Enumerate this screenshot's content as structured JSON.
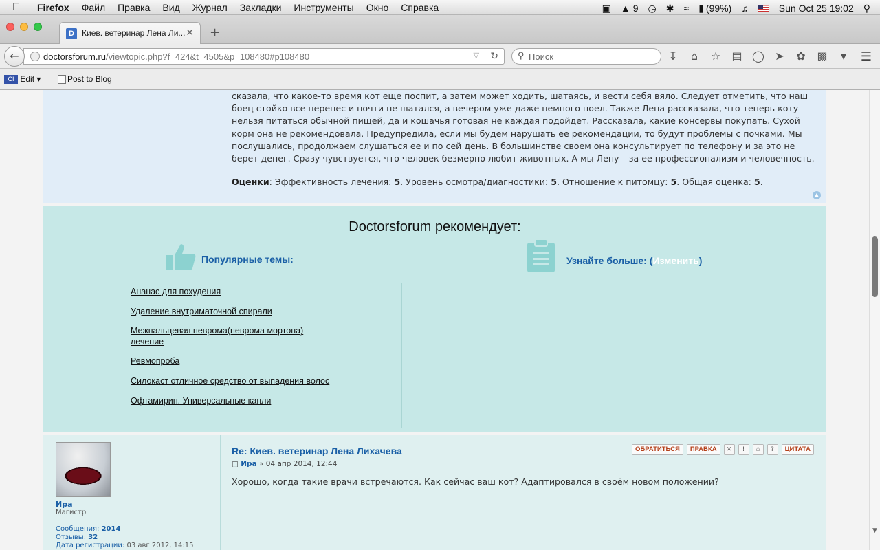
{
  "menubar": {
    "app": "Firefox",
    "items": [
      "Файл",
      "Правка",
      "Вид",
      "Журнал",
      "Закладки",
      "Инструменты",
      "Окно",
      "Справка"
    ],
    "notifications": "9",
    "battery": "(99%)",
    "clock": "Sun Oct 25  19:02"
  },
  "tab": {
    "favicon": "D",
    "title": "Киев. ветеринар Лена Ли..."
  },
  "nav": {
    "url_host": "doctorsforum.ru",
    "url_path": "/viewtopic.php?f=424&t=4505&p=108480#p108480",
    "search_placeholder": "Поиск"
  },
  "bookmarks": {
    "item1": "Edit",
    "item1_icon": "CI",
    "item2": "Post to Blog"
  },
  "post1": {
    "text": "сказала, что какое-то время кот еще поспит, а затем может ходить, шатаясь, и вести себя вяло. Следует отметить, что наш боец стойко все перенес и почти не шатался, а вечером уже даже немного поел. Также Лена рассказала, что теперь коту нельзя питаться обычной пищей, да и кошачья готовая не каждая подойдет. Рассказала, какие консервы покупать. Сухой корм она не рекомендовала. Предупредила, если мы будем нарушать ее рекомендации, то будут проблемы с почками. Мы послушались, продолжаем слушаться ее и по сей день. В большинстве своем она консультирует по телефону и за это не берет денег. Сразу чувствуется, что человек безмерно любит животных. А мы Лену – за ее профессионализм и человечность.",
    "ratings_label": "Оценки",
    "r1_label": "Эффективность лечения:",
    "r1": "5",
    "r2_label": "Уровень осмотра/диагностики:",
    "r2": "5",
    "r3_label": "Отношение к питомцу:",
    "r3": "5",
    "r4_label": "Общая оценка:",
    "r4": "5"
  },
  "recommend": {
    "title": "Doctorsforum рекомендует:",
    "popular_title": "Популярные темы:",
    "learn_title": "Узнайте больше: (",
    "learn_change": "Изменить",
    "learn_close": ")",
    "topics": [
      "Ананас для похудения",
      "Удаление внутриматочной спирали",
      "Межпальцевая неврома(неврома мортона) лечение",
      "Ревмопроба",
      "Силокаст отличное средство от выпадения волос",
      "Офтамирин. Универсальные капли"
    ]
  },
  "post2": {
    "username": "Ира",
    "rank": "Магистр",
    "messages_label": "Сообщения:",
    "messages": "2014",
    "reviews_label": "Отзывы:",
    "reviews": "32",
    "reg_label": "Дата регистрации:",
    "reg_date": "03 авг 2012, 14:15",
    "title": "Re: Киев. ветеринар Лена Лихачева",
    "author": "Ира",
    "date": "» 04 апр 2014, 12:44",
    "text": "Хорошо, когда такие врачи встречаются. Как сейчас ваш кот? Адаптировался в своём новом положении?",
    "btn_contact": "ОБРАТИТЬСЯ",
    "btn_edit": "ПРАВКА",
    "btn_quote": "ЦИТАТА"
  }
}
